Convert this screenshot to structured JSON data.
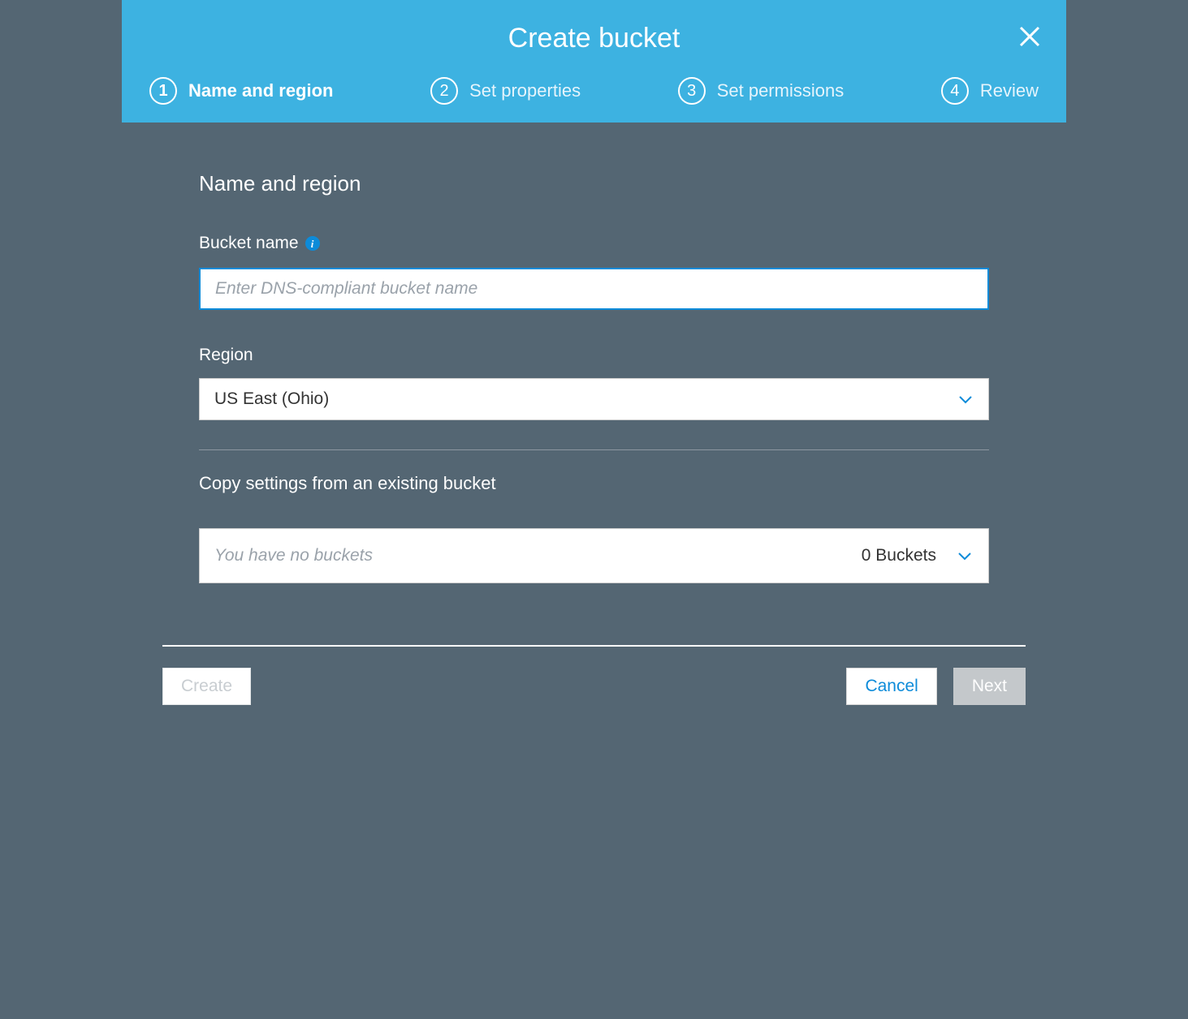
{
  "header": {
    "title": "Create bucket"
  },
  "steps": [
    {
      "num": "1",
      "label": "Name and region",
      "active": true
    },
    {
      "num": "2",
      "label": "Set properties",
      "active": false
    },
    {
      "num": "3",
      "label": "Set permissions",
      "active": false
    },
    {
      "num": "4",
      "label": "Review",
      "active": false
    }
  ],
  "form": {
    "section_title": "Name and region",
    "bucket_name_label": "Bucket name",
    "bucket_name_placeholder": "Enter DNS-compliant bucket name",
    "bucket_name_value": "",
    "region_label": "Region",
    "region_value": "US East (Ohio)",
    "copy_title": "Copy settings from an existing bucket",
    "copy_placeholder": "You have no buckets",
    "copy_count": "0 Buckets"
  },
  "footer": {
    "create_label": "Create",
    "cancel_label": "Cancel",
    "next_label": "Next"
  }
}
